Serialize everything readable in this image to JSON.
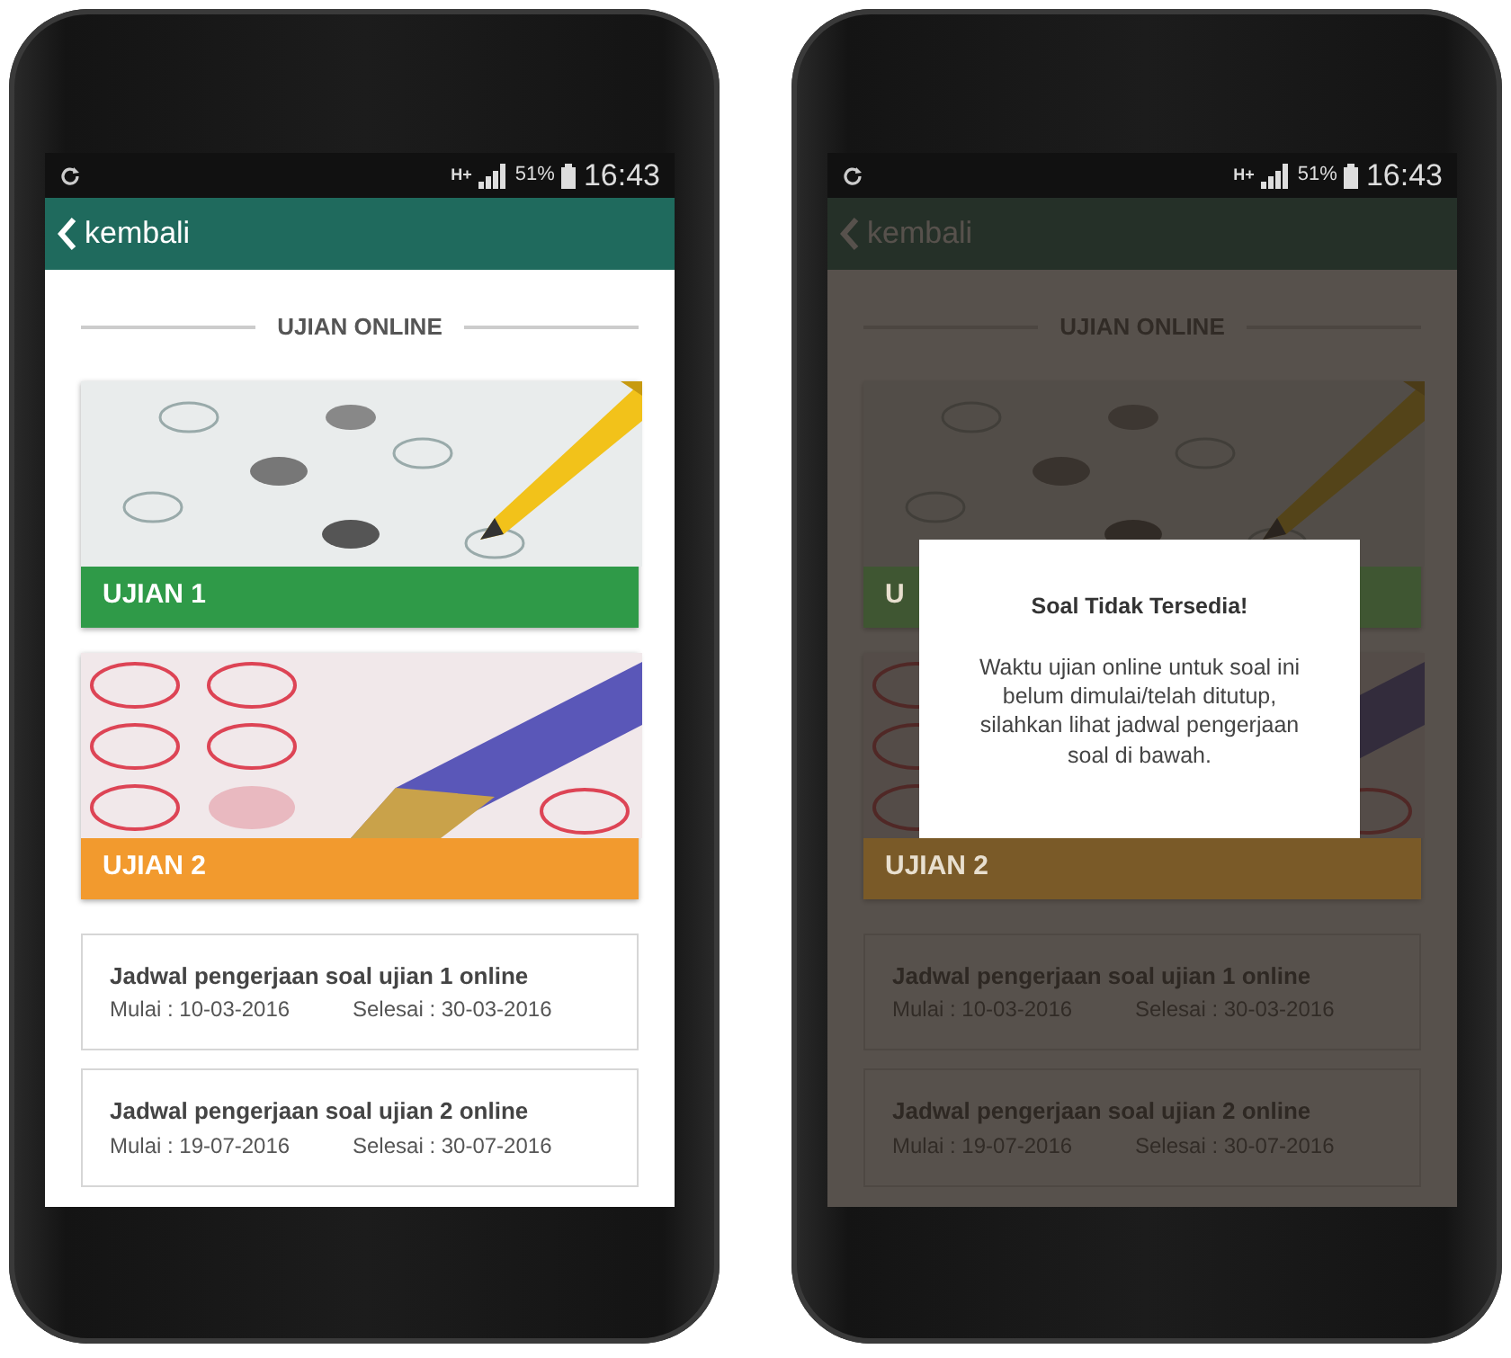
{
  "phones": [
    {
      "status_bar": {
        "network": "H+",
        "battery": "51%",
        "time": "16:43"
      },
      "back_label": "kembali",
      "section_title": "UJIAN ONLINE",
      "exams": [
        {
          "label": "UJIAN 1",
          "color": "#2f9a48"
        },
        {
          "label": "UJIAN 2",
          "color": "#f29a2e"
        }
      ],
      "schedules": [
        {
          "title": "Jadwal pengerjaan soal ujian 1 online",
          "start": "Mulai : 10-03-2016",
          "end": "Selesai : 30-03-2016"
        },
        {
          "title": "Jadwal pengerjaan soal ujian 2 online",
          "start": "Mulai : 19-07-2016",
          "end": "Selesai : 30-07-2016"
        }
      ]
    },
    {
      "status_bar": {
        "network": "H+",
        "battery": "51%",
        "time": "16:43"
      },
      "back_label": "kembali",
      "section_title": "UJIAN ONLINE",
      "exams": [
        {
          "label": "U",
          "color": "#3f5632"
        },
        {
          "label": "UJIAN 2",
          "color": "#7a5a28"
        }
      ],
      "schedules": [
        {
          "title": "Jadwal pengerjaan soal ujian 1 online",
          "start": "Mulai : 10-03-2016",
          "end": "Selesai : 30-03-2016"
        },
        {
          "title": "Jadwal pengerjaan soal ujian 2 online",
          "start": "Mulai : 19-07-2016",
          "end": "Selesai : 30-07-2016"
        }
      ],
      "dialog": {
        "title": "Soal Tidak Tersedia!",
        "message": "Waktu ujian online untuk soal ini belum dimulai/telah ditutup, silahkan lihat jadwal pengerjaan soal di bawah."
      }
    }
  ]
}
